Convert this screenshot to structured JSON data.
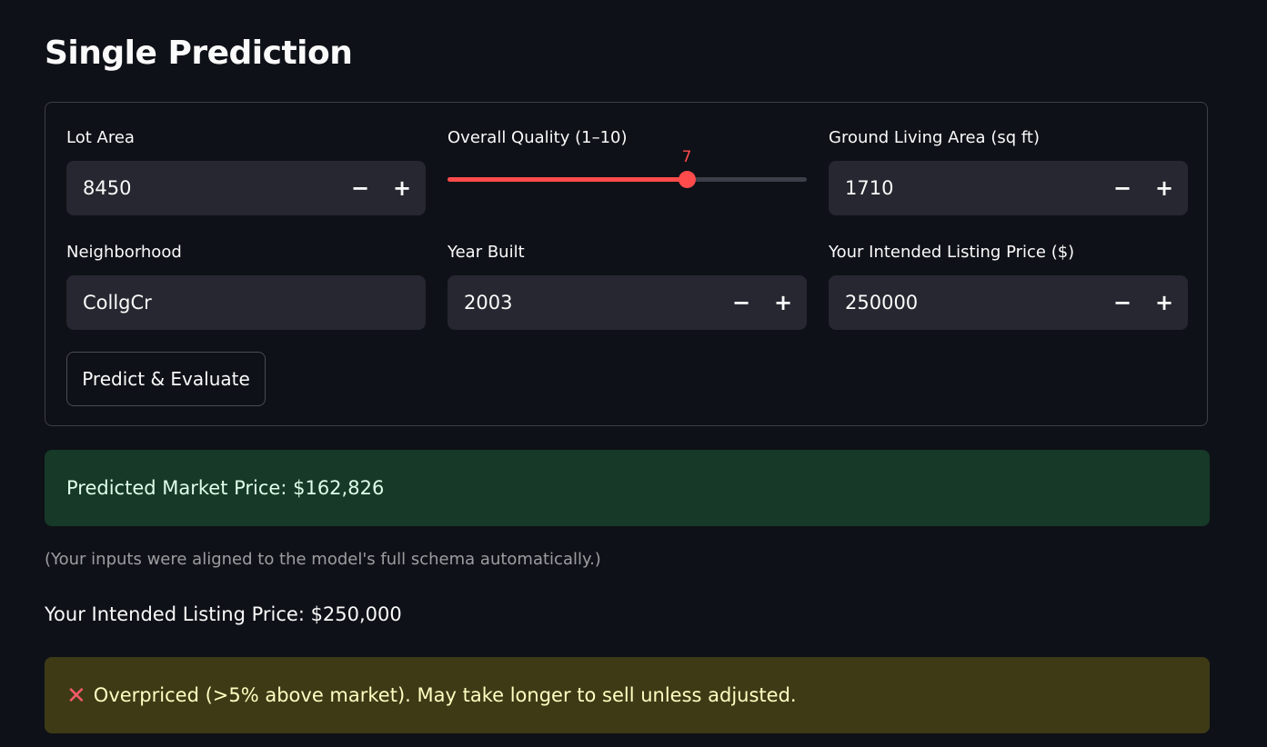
{
  "page": {
    "title": "Single Prediction"
  },
  "form": {
    "lot_area": {
      "label": "Lot Area",
      "value": "8450"
    },
    "overall_quality": {
      "label": "Overall Quality (1–10)",
      "value": "7",
      "min": 1,
      "max": 10
    },
    "ground_living_area": {
      "label": "Ground Living Area (sq ft)",
      "value": "1710"
    },
    "neighborhood": {
      "label": "Neighborhood",
      "value": "CollgCr"
    },
    "year_built": {
      "label": "Year Built",
      "value": "2003"
    },
    "listing_price": {
      "label": "Your Intended Listing Price ($)",
      "value": "250000"
    },
    "stepper": {
      "minus": "−",
      "plus": "+"
    },
    "submit_label": "Predict & Evaluate"
  },
  "results": {
    "predicted": "Predicted Market Price: $162,826",
    "caption": "(Your inputs were aligned to the model's full schema automatically.)",
    "listing": "Your Intended Listing Price: $250,000",
    "warning": "Overpriced (>5% above market). May take longer to sell unless adjusted.",
    "warning_icon": "x-mark-icon"
  },
  "colors": {
    "background": "#0e1117",
    "accent": "#ff4b4b",
    "success_bg": "#173928",
    "warning_bg": "#3e3a16"
  }
}
